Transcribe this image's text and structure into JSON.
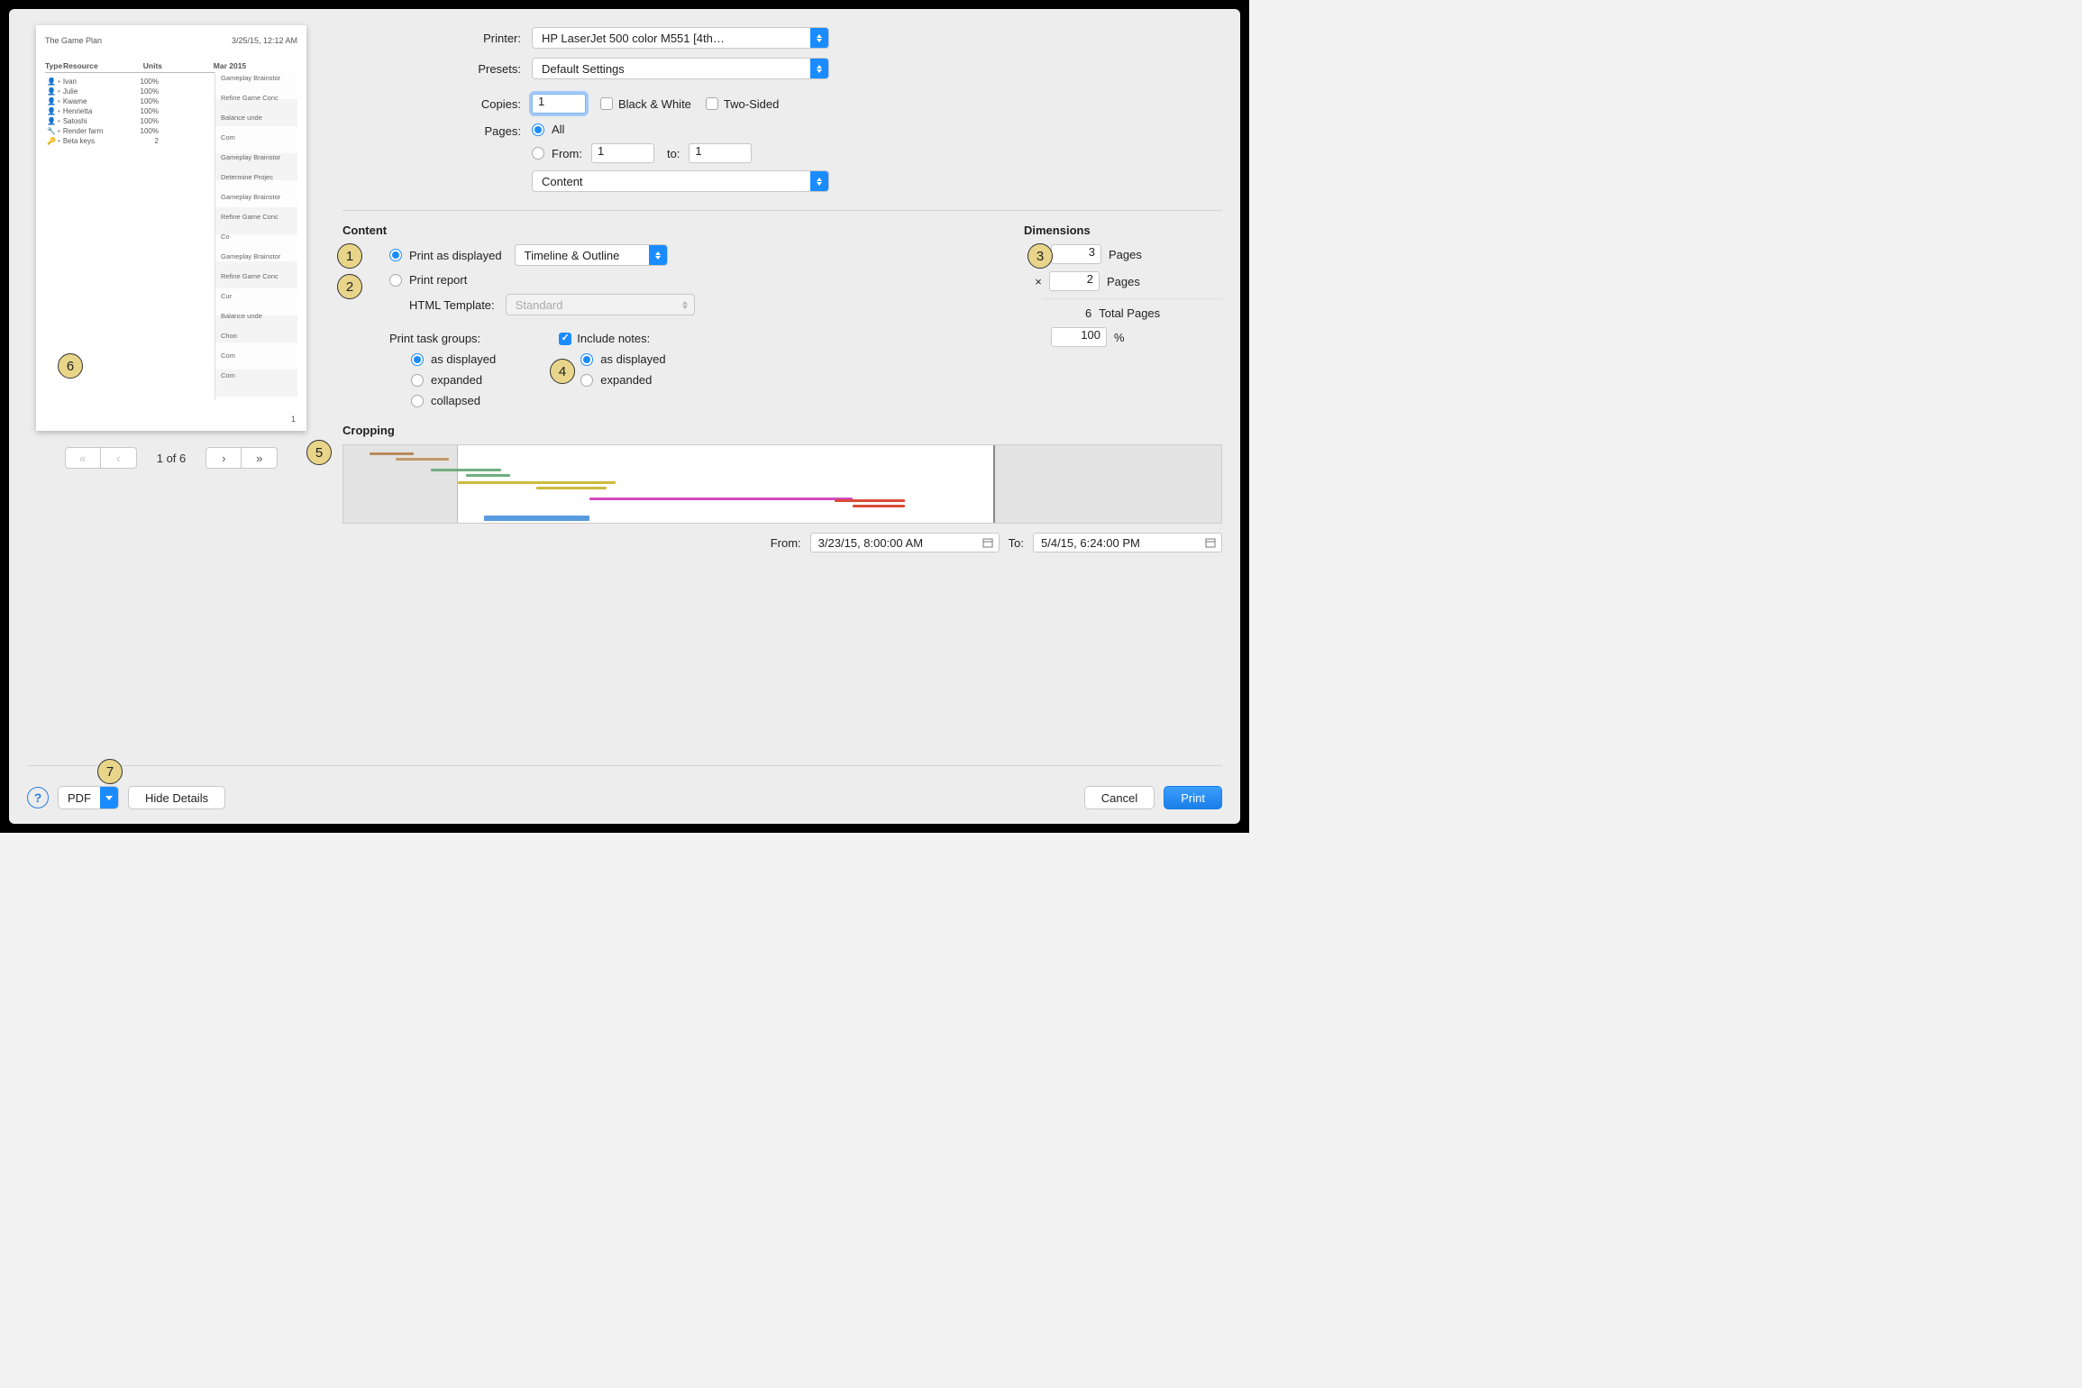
{
  "labels": {
    "printer": "Printer:",
    "presets": "Presets:",
    "copies": "Copies:",
    "black_white": "Black & White",
    "two_sided": "Two-Sided",
    "pages": "Pages:",
    "all": "All",
    "from": "From:",
    "to": "to:",
    "content_header": "Content",
    "dimensions_header": "Dimensions",
    "print_as_displayed": "Print as displayed",
    "print_report": "Print report",
    "html_template": "HTML Template:",
    "print_task_groups": "Print task groups:",
    "as_displayed": "as displayed",
    "expanded": "expanded",
    "collapsed": "collapsed",
    "include_notes": "Include notes:",
    "pages_unit": "Pages",
    "total_pages": "Total Pages",
    "percent": "%",
    "cropping_header": "Cropping",
    "crop_from": "From:",
    "crop_to": "To:",
    "pdf": "PDF",
    "hide_details": "Hide Details",
    "cancel": "Cancel",
    "print": "Print",
    "times": "×"
  },
  "values": {
    "printer": "HP LaserJet 500 color M551 [4th…",
    "presets": "Default Settings",
    "copies": "1",
    "pages_from": "1",
    "pages_to": "1",
    "section_select": "Content",
    "view_select": "Timeline & Outline",
    "template_select": "Standard",
    "dim_w": "3",
    "dim_h": "2",
    "total_pages": "6",
    "scale_pct": "100",
    "crop_from": "3/23/15, 8:00:00 AM",
    "crop_to": "5/4/15, 6:24:00 PM",
    "page_indicator": "1 of 6"
  },
  "callouts": {
    "c1": "1",
    "c2": "2",
    "c3": "3",
    "c4": "4",
    "c5": "5",
    "c6": "6",
    "c7": "7"
  },
  "preview": {
    "title": "The Game Plan",
    "datetime": "3/25/15, 12:12 AM",
    "cols": {
      "type": "Type",
      "resource": "Resource",
      "units": "Units",
      "month": "Mar 2015"
    },
    "page_num": "1",
    "rows": [
      {
        "icon": "👤",
        "name": "Ivan",
        "units": "100%"
      },
      {
        "icon": "👤",
        "name": "Julie",
        "units": "100%"
      },
      {
        "icon": "👤",
        "name": "Kwame",
        "units": "100%"
      },
      {
        "icon": "👤",
        "name": "Henrietta",
        "units": "100%"
      },
      {
        "icon": "👤",
        "name": "Satoshi",
        "units": "100%"
      },
      {
        "icon": "🔧",
        "name": "Render farm",
        "units": "100%"
      },
      {
        "icon": "🔑",
        "name": "Beta keys",
        "units": "2"
      }
    ],
    "gantt_labels": [
      "Gameplay Brainstor",
      "Refine Game Conc",
      "Balance unde",
      "Com",
      "Gameplay Brainstor",
      "Determine Projec",
      "Gameplay Brainstor",
      "Refine Game Conc",
      "Co",
      "Gameplay Brainstor",
      "Refine Game Conc",
      "Cur",
      "Balance unde",
      "Choo",
      "Com",
      "Com"
    ],
    "side_labels": [
      "Ivan",
      "Julie",
      "Kwame",
      "Henrietta",
      "Satoshi"
    ]
  }
}
